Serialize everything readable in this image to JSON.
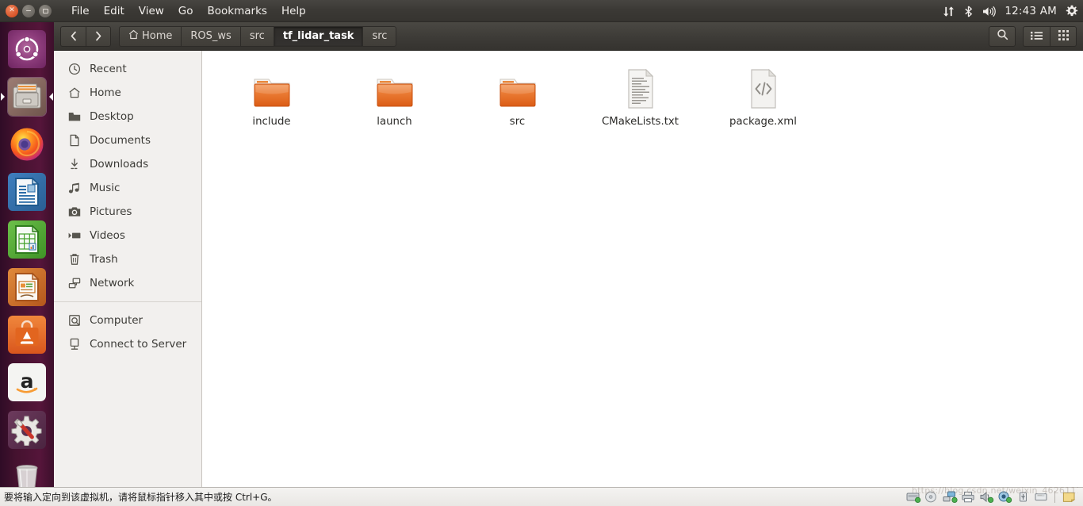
{
  "top_panel": {
    "window_controls": [
      {
        "name": "close",
        "glyph": "×"
      },
      {
        "name": "minimize",
        "glyph": "–"
      },
      {
        "name": "maximize",
        "glyph": "□"
      }
    ],
    "menus": [
      "File",
      "Edit",
      "View",
      "Go",
      "Bookmarks",
      "Help"
    ],
    "indicators": [
      "network-icon",
      "bluetooth-icon",
      "volume-icon",
      "gear-icon"
    ],
    "clock": "12:43 AM"
  },
  "launcher": {
    "items": [
      {
        "name": "ubuntu-dash",
        "label": "Ubuntu Dash",
        "active": false
      },
      {
        "name": "files",
        "label": "Files",
        "active": true
      },
      {
        "name": "firefox",
        "label": "Firefox",
        "active": false
      },
      {
        "name": "libreoffice-writer",
        "label": "LibreOffice Writer",
        "active": false
      },
      {
        "name": "libreoffice-calc",
        "label": "LibreOffice Calc",
        "active": false
      },
      {
        "name": "libreoffice-impress",
        "label": "LibreOffice Impress",
        "active": false
      },
      {
        "name": "ubuntu-software",
        "label": "Ubuntu Software",
        "active": false
      },
      {
        "name": "amazon",
        "label": "Amazon",
        "active": false
      },
      {
        "name": "system-settings",
        "label": "System Settings",
        "active": false
      },
      {
        "name": "trash",
        "label": "Trash",
        "active": false
      }
    ]
  },
  "toolbar": {
    "back_label": "‹",
    "forward_label": "›",
    "breadcrumbs": [
      {
        "label": "Home",
        "icon": "home-icon",
        "active": false
      },
      {
        "label": "ROS_ws",
        "icon": "",
        "active": false
      },
      {
        "label": "src",
        "icon": "",
        "active": false
      },
      {
        "label": "tf_lidar_task",
        "icon": "",
        "active": true
      },
      {
        "label": "src",
        "icon": "",
        "active": false
      }
    ],
    "search_icon": "search-icon",
    "list_view_icon": "list-view-icon",
    "grid_view_icon": "grid-view-icon"
  },
  "sidebar": {
    "groups": [
      {
        "items": [
          {
            "label": "Recent",
            "icon": "clock-icon"
          },
          {
            "label": "Home",
            "icon": "home-icon"
          },
          {
            "label": "Desktop",
            "icon": "folder-icon"
          },
          {
            "label": "Documents",
            "icon": "document-icon"
          },
          {
            "label": "Downloads",
            "icon": "download-icon"
          },
          {
            "label": "Music",
            "icon": "music-icon"
          },
          {
            "label": "Pictures",
            "icon": "camera-icon"
          },
          {
            "label": "Videos",
            "icon": "video-icon"
          },
          {
            "label": "Trash",
            "icon": "trash-icon"
          },
          {
            "label": "Network",
            "icon": "network-icon"
          }
        ]
      },
      {
        "items": [
          {
            "label": "Computer",
            "icon": "computer-icon"
          },
          {
            "label": "Connect to Server",
            "icon": "server-icon"
          }
        ]
      }
    ]
  },
  "content": {
    "files": [
      {
        "name": "include",
        "type": "folder"
      },
      {
        "name": "launch",
        "type": "folder"
      },
      {
        "name": "src",
        "type": "folder"
      },
      {
        "name": "CMakeLists.txt",
        "type": "text"
      },
      {
        "name": "package.xml",
        "type": "code"
      }
    ]
  },
  "vm_status": {
    "message": "要将输入定向到该虚拟机，请将鼠标指针移入其中或按 Ctrl+G。",
    "tray_icons": [
      "harddisk-icon",
      "cdrom-icon",
      "network-icon",
      "printer-icon",
      "sound-icon",
      "camera-icon",
      "usb-icon",
      "floppy-icon",
      "note-icon"
    ]
  },
  "colors": {
    "panel": "#3b3935",
    "launcher": "#55153a",
    "sidebar": "#f2f0ee",
    "folder_orange": "#e8722e",
    "accent": "#dd4814"
  }
}
